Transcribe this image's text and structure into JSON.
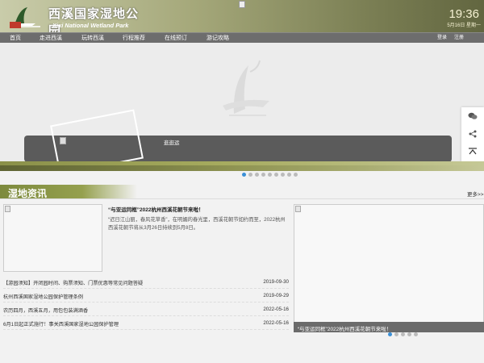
{
  "header": {
    "logo_cn": "西溪国家湿地公园",
    "logo_en": "Xixi National Wetland Park",
    "time": "19:36",
    "date": "5月16日 星期一"
  },
  "nav": {
    "items": [
      {
        "label": "首页"
      },
      {
        "label": "走进西溪"
      },
      {
        "label": "玩转西溪"
      },
      {
        "label": "行程推荐"
      },
      {
        "label": "在线预订"
      },
      {
        "label": "游记攻略"
      }
    ],
    "login": "登录",
    "register": "注册"
  },
  "banner": {
    "caption": "逛逛运",
    "slide_count": 9,
    "active_slide": 0
  },
  "side_tools": [
    "wechat-icon",
    "share-icon",
    "back-to-top-icon"
  ],
  "news": {
    "section_title": "湿地资讯",
    "more": "更多>>",
    "featured": {
      "title": "“与亚运同框”2022杭州西溪花朝节来啦！",
      "desc": "“迟日江山丽，春风花草香”，在明媚的春光里，西溪花朝节如约而至，2022杭州西溪花朝节将从3月26日持续到5月8日。"
    },
    "list": [
      {
        "title": "【游园须知】开闭园时间、购票须知、门票优惠等常见问题答疑",
        "date": "2019-09-30"
      },
      {
        "title": "杭州西溪国家湿地公园保护管理条例",
        "date": "2019-09-29"
      },
      {
        "title": "农历四月，西溪五月，用包包装满酒香",
        "date": "2022-05-16"
      },
      {
        "title": "6月1日起正式施行！事关西溪国家湿地公园保护管理",
        "date": "2022-05-16"
      }
    ],
    "right_card": {
      "caption": "“与亚运同框”2022杭州西溪花朝节来啦！",
      "slide_count": 5,
      "active_slide": 0
    }
  },
  "colors": {
    "accent_olive": "#8a9049",
    "nav_bg": "#6d6d6d",
    "active_dot": "#3b8fd6"
  }
}
